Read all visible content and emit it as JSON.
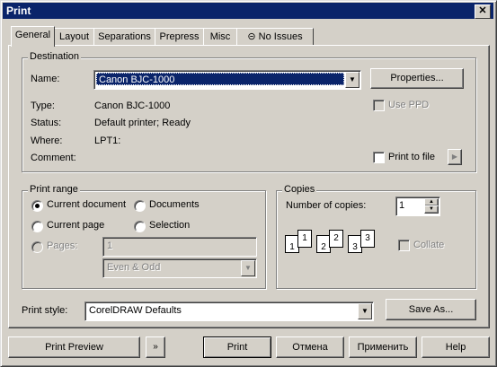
{
  "window": {
    "title": "Print"
  },
  "tabs": [
    {
      "label": "General"
    },
    {
      "label": "Layout"
    },
    {
      "label": "Separations"
    },
    {
      "label": "Prepress"
    },
    {
      "label": "Misc"
    },
    {
      "label": "No Issues"
    }
  ],
  "destination": {
    "group_label": "Destination",
    "name_label": "Name:",
    "name_value": "Canon BJC-1000",
    "properties_button": "Properties...",
    "use_ppd_label": "Use PPD",
    "type_label": "Type:",
    "type_value": "Canon BJC-1000",
    "status_label": "Status:",
    "status_value": "Default printer; Ready",
    "where_label": "Where:",
    "where_value": "LPT1:",
    "comment_label": "Comment:",
    "print_to_file_label": "Print to file"
  },
  "print_range": {
    "group_label": "Print range",
    "current_document": "Current document",
    "documents": "Documents",
    "current_page": "Current page",
    "selection": "Selection",
    "pages_label": "Pages:",
    "pages_value": "1",
    "even_odd_value": "Even & Odd"
  },
  "copies": {
    "group_label": "Copies",
    "number_label": "Number of copies:",
    "number_value": "1",
    "collate_label": "Collate"
  },
  "print_style": {
    "label": "Print style:",
    "value": "CorelDRAW Defaults",
    "save_as_button": "Save As..."
  },
  "footer": {
    "print_preview": "Print Preview",
    "print": "Print",
    "cancel": "Отмена",
    "apply": "Применить",
    "help": "Help"
  }
}
